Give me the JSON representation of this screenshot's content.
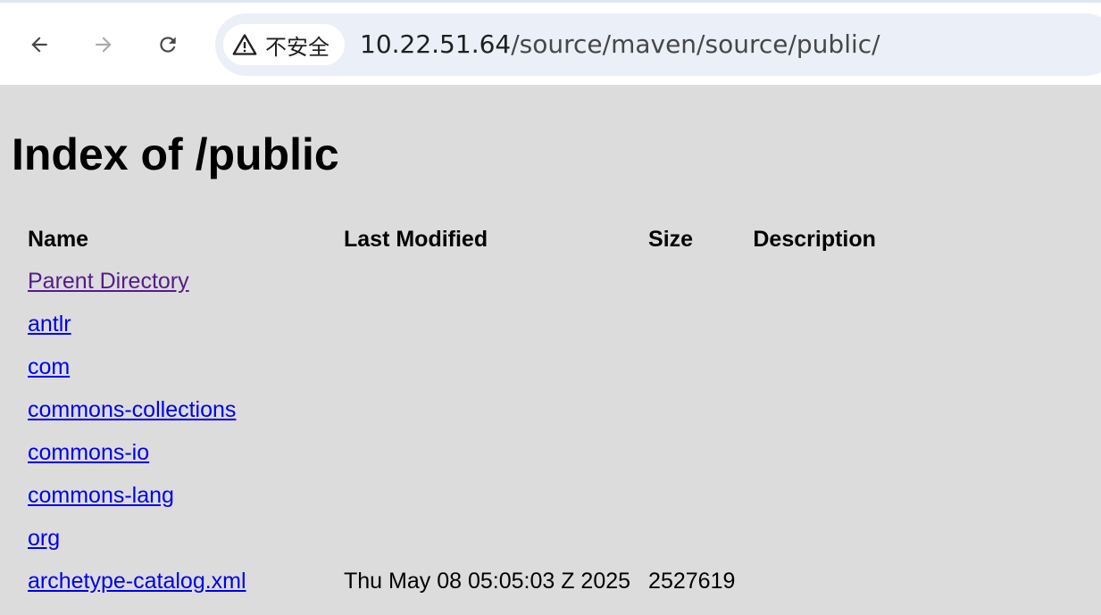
{
  "browser": {
    "security_label": "不安全",
    "url_host": "10.22.51.64",
    "url_path": "/source/maven/source/public/",
    "icons": {
      "back": "arrow-left-icon",
      "forward": "arrow-right-icon",
      "reload": "reload-icon",
      "security": "warning-triangle-icon"
    }
  },
  "page": {
    "title": "Index of /public",
    "columns": {
      "name": "Name",
      "last_modified": "Last Modified",
      "size": "Size",
      "description": "Description"
    },
    "entries": [
      {
        "name": "Parent Directory",
        "last_modified": "",
        "size": "",
        "description": "",
        "visited": true
      },
      {
        "name": "antlr",
        "last_modified": "",
        "size": "",
        "description": ""
      },
      {
        "name": "com",
        "last_modified": "",
        "size": "",
        "description": ""
      },
      {
        "name": "commons-collections",
        "last_modified": "",
        "size": "",
        "description": ""
      },
      {
        "name": "commons-io",
        "last_modified": "",
        "size": "",
        "description": ""
      },
      {
        "name": "commons-lang",
        "last_modified": "",
        "size": "",
        "description": ""
      },
      {
        "name": "org",
        "last_modified": "",
        "size": "",
        "description": ""
      },
      {
        "name": "archetype-catalog.xml",
        "last_modified": "Thu May 08 05:05:03 Z 2025",
        "size": "2527619",
        "description": ""
      }
    ],
    "colors": {
      "background": "#dcdcdc",
      "link": "#0000ee",
      "visited_link": "#551a8b"
    }
  }
}
